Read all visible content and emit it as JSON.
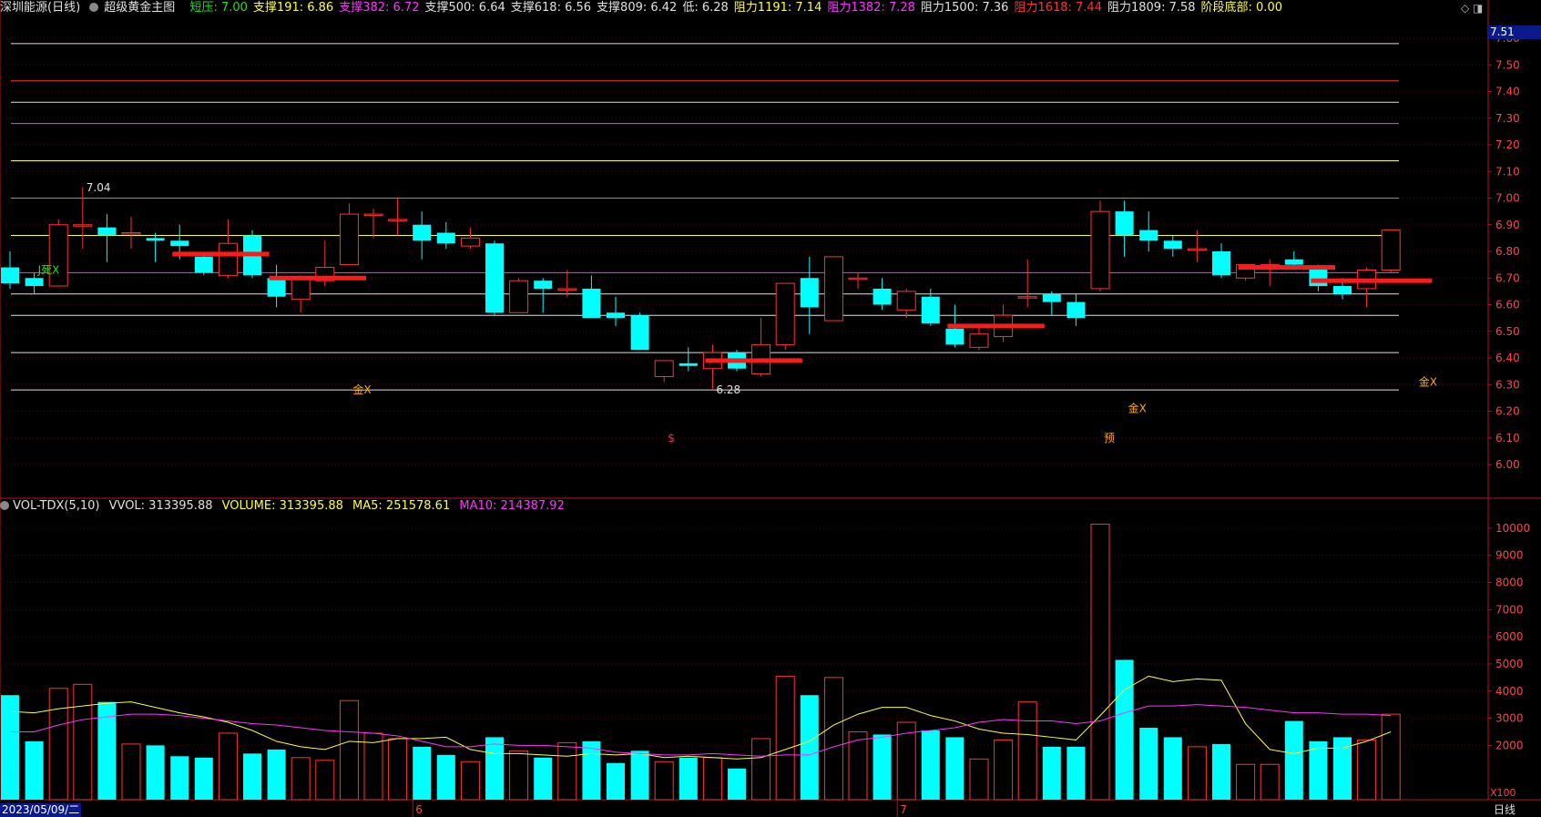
{
  "header": {
    "stock": "深圳能源(日线)",
    "indicator": "超级黄金主图",
    "items": [
      {
        "label": "短压: 7.00",
        "color": "#22dd22"
      },
      {
        "label": "支撑191: 6.86",
        "color": "#ffff33"
      },
      {
        "label": "支撑382: 6.72",
        "color": "#ff33ff"
      },
      {
        "label": "支撑500: 6.64",
        "color": "#e0e0e0"
      },
      {
        "label": "支撑618: 6.56",
        "color": "#e0e0e0"
      },
      {
        "label": "支撑809: 6.42",
        "color": "#e0e0e0"
      },
      {
        "label": "低: 6.28",
        "color": "#e0e0e0"
      },
      {
        "label": "阻力1191: 7.14",
        "color": "#ffff33"
      },
      {
        "label": "阻力1382: 7.28",
        "color": "#ff33ff"
      },
      {
        "label": "阻力1500: 7.36",
        "color": "#e0e0e0"
      },
      {
        "label": "阻力1618: 7.44",
        "color": "#ff3333"
      },
      {
        "label": "阻力1809: 7.58",
        "color": "#e0e0e0"
      },
      {
        "label": "阶段底部: 0.00",
        "color": "#ffff33"
      }
    ]
  },
  "vol_header": {
    "name": "VOL-TDX(5,10)",
    "vvol": "VVOL: 313395.88",
    "volume": "VOLUME: 313395.88",
    "ma5": "MA5: 251578.61",
    "ma10": "MA10: 214387.92"
  },
  "colors": {
    "up": "#ff3232",
    "down": "#00ffff",
    "frame": "#b01818",
    "ma5": "#ffff33",
    "ma10": "#ff33ff"
  },
  "date_label": "2023/05/09/二",
  "period_label": "日线",
  "top_icons": "◇ ◨",
  "price_tag": "7.51",
  "chart_data": {
    "type": "candlestick",
    "price_axis": {
      "range": [
        5.95,
        7.65
      ],
      "ticks": [
        "7.60",
        "7.50",
        "7.40",
        "7.30",
        "7.20",
        "7.10",
        "7.00",
        "6.90",
        "6.80",
        "6.70",
        "6.60",
        "6.50",
        "6.40",
        "6.30",
        "6.20",
        "6.10",
        "6.00"
      ]
    },
    "volume_axis": {
      "range": [
        0,
        10500
      ],
      "ticks": [
        "10000",
        "9000",
        "8000",
        "7000",
        "6000",
        "5000",
        "4000",
        "3000",
        "2000"
      ],
      "unit": "X100"
    },
    "month_markers": [
      {
        "index": 17,
        "label": "6"
      },
      {
        "index": 37,
        "label": "7"
      }
    ],
    "levels": [
      {
        "value": 7.58,
        "color": "#e0e0e0"
      },
      {
        "value": 7.44,
        "color": "#ff3333"
      },
      {
        "value": 7.36,
        "color": "#e0e0e0"
      },
      {
        "value": 7.28,
        "color": "#ff33ff"
      },
      {
        "value": 7.14,
        "color": "#ffff33"
      },
      {
        "value": 7.0,
        "color": "#22dd22"
      },
      {
        "value": 6.86,
        "color": "#ffff33"
      },
      {
        "value": 6.72,
        "color": "#ff33ff"
      },
      {
        "value": 6.64,
        "color": "#e0e0e0"
      },
      {
        "value": 6.56,
        "color": "#e0e0e0"
      },
      {
        "value": 6.42,
        "color": "#e0e0e0"
      },
      {
        "value": 6.28,
        "color": "#e0e0e0"
      }
    ],
    "candles": [
      [
        6.74,
        6.68,
        6.8,
        6.66
      ],
      [
        6.7,
        6.67,
        6.72,
        6.64
      ],
      [
        6.67,
        6.9,
        6.92,
        6.67
      ],
      [
        6.9,
        6.9,
        7.04,
        6.81
      ],
      [
        6.89,
        6.86,
        6.94,
        6.76
      ],
      [
        6.87,
        6.87,
        6.93,
        6.81
      ],
      [
        6.85,
        6.84,
        6.87,
        6.76
      ],
      [
        6.84,
        6.82,
        6.9,
        6.77
      ],
      [
        6.78,
        6.72,
        6.79,
        6.71
      ],
      [
        6.71,
        6.83,
        6.92,
        6.7
      ],
      [
        6.86,
        6.71,
        6.88,
        6.7
      ],
      [
        6.7,
        6.63,
        6.75,
        6.59
      ],
      [
        6.62,
        6.7,
        6.71,
        6.57
      ],
      [
        6.69,
        6.74,
        6.84,
        6.67
      ],
      [
        6.75,
        6.94,
        6.98,
        6.75
      ],
      [
        6.94,
        6.94,
        6.96,
        6.85
      ],
      [
        6.92,
        6.92,
        7.0,
        6.86
      ],
      [
        6.9,
        6.84,
        6.95,
        6.77
      ],
      [
        6.87,
        6.83,
        6.91,
        6.81
      ],
      [
        6.82,
        6.85,
        6.89,
        6.81
      ],
      [
        6.83,
        6.57,
        6.84,
        6.56
      ],
      [
        6.57,
        6.69,
        6.7,
        6.57
      ],
      [
        6.69,
        6.66,
        6.7,
        6.57
      ],
      [
        6.66,
        6.66,
        6.73,
        6.63
      ],
      [
        6.66,
        6.55,
        6.71,
        6.55
      ],
      [
        6.57,
        6.55,
        6.63,
        6.52
      ],
      [
        6.56,
        6.43,
        6.57,
        6.43
      ],
      [
        6.33,
        6.39,
        6.39,
        6.31
      ],
      [
        6.38,
        6.37,
        6.44,
        6.35
      ],
      [
        6.36,
        6.42,
        6.45,
        6.28
      ],
      [
        6.42,
        6.36,
        6.43,
        6.35
      ],
      [
        6.34,
        6.45,
        6.55,
        6.33
      ],
      [
        6.45,
        6.68,
        6.68,
        6.43
      ],
      [
        6.7,
        6.59,
        6.78,
        6.49
      ],
      [
        6.54,
        6.78,
        6.78,
        6.54
      ],
      [
        6.7,
        6.7,
        6.72,
        6.66
      ],
      [
        6.66,
        6.6,
        6.7,
        6.58
      ],
      [
        6.58,
        6.65,
        6.66,
        6.55
      ],
      [
        6.63,
        6.53,
        6.66,
        6.52
      ],
      [
        6.51,
        6.45,
        6.6,
        6.44
      ],
      [
        6.44,
        6.49,
        6.52,
        6.43
      ],
      [
        6.48,
        6.56,
        6.6,
        6.46
      ],
      [
        6.63,
        6.63,
        6.77,
        6.59
      ],
      [
        6.64,
        6.61,
        6.65,
        6.56
      ],
      [
        6.61,
        6.55,
        6.64,
        6.52
      ],
      [
        6.66,
        6.95,
        6.99,
        6.65
      ],
      [
        6.95,
        6.86,
        6.99,
        6.78
      ],
      [
        6.88,
        6.84,
        6.95,
        6.8
      ],
      [
        6.84,
        6.81,
        6.86,
        6.78
      ],
      [
        6.81,
        6.81,
        6.88,
        6.76
      ],
      [
        6.8,
        6.71,
        6.83,
        6.7
      ],
      [
        6.7,
        6.75,
        6.75,
        6.69
      ],
      [
        6.75,
        6.75,
        6.77,
        6.67
      ],
      [
        6.77,
        6.75,
        6.8,
        6.73
      ],
      [
        6.74,
        6.67,
        6.75,
        6.65
      ],
      [
        6.67,
        6.64,
        6.7,
        6.62
      ],
      [
        6.66,
        6.73,
        6.74,
        6.59
      ],
      [
        6.73,
        6.88,
        6.88,
        6.72
      ]
    ],
    "volumes": [
      3850,
      2150,
      4100,
      4250,
      3600,
      2050,
      2000,
      1600,
      1550,
      2450,
      1700,
      1850,
      1550,
      1450,
      3650,
      2450,
      2250,
      1950,
      1650,
      1400,
      2300,
      1800,
      1550,
      2100,
      2150,
      1350,
      1800,
      1400,
      1550,
      1550,
      1150,
      2250,
      4550,
      3850,
      4500,
      2500,
      2400,
      2850,
      2550,
      2300,
      1500,
      2200,
      3600,
      1950,
      1950,
      10150,
      5150,
      2650,
      2300,
      1950,
      2050,
      1300,
      1300,
      2900,
      2150,
      2300,
      2200,
      3150
    ],
    "ma5": [
      3250,
      3200,
      3350,
      3450,
      3550,
      3600,
      3400,
      3200,
      3050,
      2850,
      2550,
      2150,
      1950,
      1850,
      2150,
      2100,
      2250,
      2250,
      2300,
      1850,
      1700,
      1700,
      1650,
      1600,
      1700,
      1650,
      1700,
      1550,
      1600,
      1550,
      1500,
      1550,
      1850,
      2150,
      2750,
      3150,
      3400,
      3400,
      3100,
      2900,
      2600,
      2450,
      2400,
      2300,
      2200,
      3100,
      4050,
      4550,
      4350,
      4450,
      4400,
      2800,
      1850,
      1700,
      1900,
      1900,
      2150,
      2500
    ],
    "ma10": [
      2500,
      2500,
      2750,
      2950,
      3050,
      3150,
      3150,
      3100,
      3000,
      2900,
      2800,
      2750,
      2650,
      2550,
      2500,
      2450,
      2350,
      2150,
      1950,
      1950,
      2050,
      2000,
      2000,
      1950,
      1900,
      1750,
      1700,
      1650,
      1650,
      1700,
      1650,
      1600,
      1650,
      1650,
      1950,
      2200,
      2300,
      2450,
      2550,
      2650,
      2850,
      2950,
      2900,
      2900,
      2800,
      2900,
      3200,
      3450,
      3450,
      3500,
      3450,
      3400,
      3300,
      3200,
      3200,
      3150,
      3150,
      3100
    ],
    "horizontal_bars": [
      {
        "from": 7,
        "to": 11,
        "value": 6.79,
        "color": "#ff1a1a"
      },
      {
        "from": 11,
        "to": 15,
        "value": 6.7,
        "color": "#ff1a1a"
      },
      {
        "from": 29,
        "to": 33,
        "value": 6.39,
        "color": "#ff1a1a"
      },
      {
        "from": 39,
        "to": 43,
        "value": 6.52,
        "color": "#ff1a1a"
      },
      {
        "from": 51,
        "to": 55,
        "value": 6.74,
        "color": "#ff1a1a"
      },
      {
        "from": 54,
        "to": 59,
        "value": 6.69,
        "color": "#ff1a1a"
      }
    ],
    "annotations": [
      {
        "index": 3,
        "price": 7.04,
        "text": "7.04",
        "color": "#e0e0e0"
      },
      {
        "index": 29,
        "price": 6.28,
        "text": "6.28",
        "color": "#e0e0e0"
      },
      {
        "index": 1,
        "price": 6.73,
        "text": "J死X",
        "color": "#22dd22"
      },
      {
        "index": 14,
        "price": 6.28,
        "text": "金X",
        "color": "#ffaa00"
      },
      {
        "index": 46,
        "price": 6.21,
        "text": "金X",
        "color": "#ffaa00"
      },
      {
        "index": 58,
        "price": 6.31,
        "text": "金X",
        "color": "#ffaa00"
      },
      {
        "index": 27,
        "price": 6.1,
        "text": "$",
        "color": "#ff3333"
      },
      {
        "index": 45,
        "price": 6.1,
        "text": "预",
        "color": "#ffaa00"
      }
    ]
  }
}
